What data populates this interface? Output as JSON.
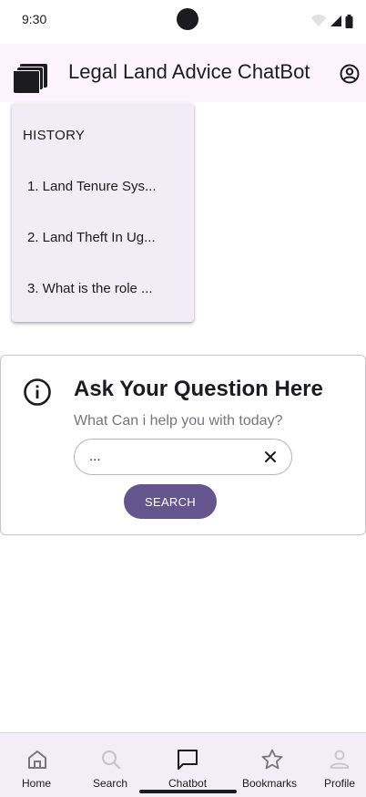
{
  "status_bar": {
    "time": "9:30",
    "icons": [
      "wifi-icon",
      "signal-icon",
      "battery-icon"
    ]
  },
  "app_bar": {
    "logo_icon": "book-stack-logo",
    "title": "Legal Land Advice ChatBot",
    "account_icon": "account-circle-icon"
  },
  "history": {
    "heading": "HISTORY",
    "items": [
      {
        "label": "1. Land Tenure Sys..."
      },
      {
        "label": "2. Land Theft In Ug..."
      },
      {
        "label": "3. What is the role ..."
      }
    ]
  },
  "question_card": {
    "icon": "info-icon",
    "title": "Ask Your Question Here",
    "subtitle": "What Can i help you with today?",
    "input_value": "...",
    "clear_icon": "close-icon",
    "button_label": "SEARCH"
  },
  "bottom_nav": {
    "items": [
      {
        "label": "Home",
        "icon": "home-icon",
        "active": false
      },
      {
        "label": "Search",
        "icon": "search-icon",
        "active": false
      },
      {
        "label": "Chatbot",
        "icon": "chat-icon",
        "active": true
      },
      {
        "label": "Bookmarks",
        "icon": "star-icon",
        "active": false
      },
      {
        "label": "Profile",
        "icon": "person-icon",
        "active": false
      }
    ]
  },
  "colors": {
    "primary": "#65558f",
    "app_bar_bg": "#fdf4fd",
    "menu_bg": "#f1ecf6",
    "nav_bg": "#f3edf7",
    "muted_text": "#79747e",
    "disabled_icon": "#c9c5cc"
  }
}
